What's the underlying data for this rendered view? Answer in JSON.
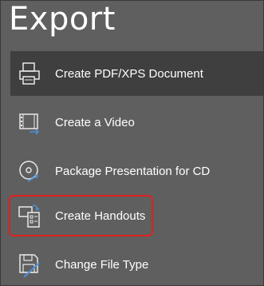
{
  "header": {
    "title": "Export"
  },
  "menu": {
    "items": [
      {
        "label": "Create PDF/XPS Document",
        "icon": "pdf-document-icon",
        "selected": true
      },
      {
        "label": "Create a Video",
        "icon": "video-icon",
        "selected": false
      },
      {
        "label": "Package Presentation for CD",
        "icon": "cd-icon",
        "selected": false
      },
      {
        "label": "Create Handouts",
        "icon": "handouts-icon",
        "selected": false,
        "highlighted": true
      },
      {
        "label": "Change File Type",
        "icon": "file-type-icon",
        "selected": false
      }
    ]
  },
  "colors": {
    "background": "#5f5f5f",
    "selected_background": "#3f3f3f",
    "highlight_border": "#e02020",
    "icon_accent": "#4a90d9",
    "text": "#ffffff"
  }
}
